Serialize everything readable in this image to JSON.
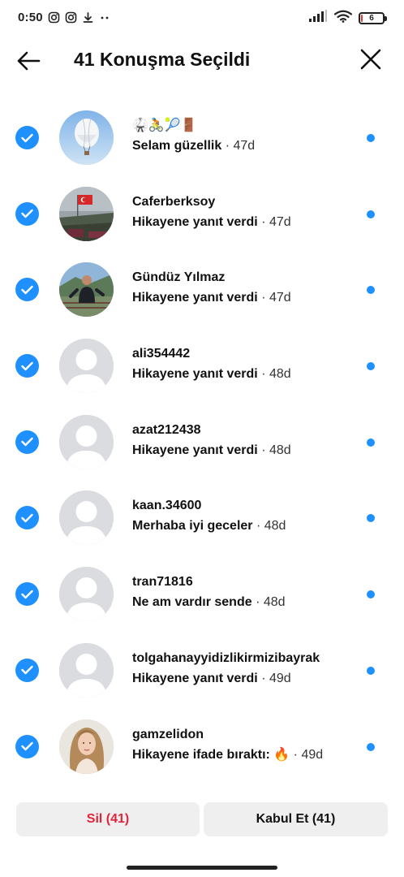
{
  "status_bar": {
    "time": "0:50",
    "left_icons": [
      "instagram-icon",
      "instagram-icon",
      "download-icon",
      "more-dots-icon"
    ],
    "right_icons": [
      "signal-icon",
      "wifi-icon",
      "battery-icon"
    ],
    "battery_level": "6"
  },
  "header": {
    "title": "41 Konuşma Seçildi",
    "back_icon": "arrow-left-icon",
    "close_icon": "close-icon"
  },
  "conversations": [
    {
      "name": "🥋🚴🎾🚪",
      "message": "Selam güzellik",
      "time": "· 47d",
      "avatar": "balloon-photo",
      "selected": true,
      "unread": true
    },
    {
      "name": "Caferberksoy",
      "message": "Hikayene yanıt verdi",
      "time": "· 47d",
      "avatar": "flag-photo",
      "selected": true,
      "unread": true
    },
    {
      "name": "Gündüz Yılmaz",
      "message": "Hikayene yanıt verdi",
      "time": "· 47d",
      "avatar": "person-photo",
      "selected": true,
      "unread": true
    },
    {
      "name": "ali354442",
      "message": "Hikayene yanıt verdi",
      "time": "· 48d",
      "avatar": "default-avatar",
      "selected": true,
      "unread": true
    },
    {
      "name": "azat212438",
      "message": "Hikayene yanıt verdi",
      "time": "· 48d",
      "avatar": "default-avatar",
      "selected": true,
      "unread": true
    },
    {
      "name": "kaan.34600",
      "message": "Merhaba iyi geceler",
      "time": "· 48d",
      "avatar": "default-avatar",
      "selected": true,
      "unread": true
    },
    {
      "name": "tran71816",
      "message": "Ne am vardır sende",
      "time": "· 48d",
      "avatar": "default-avatar",
      "selected": true,
      "unread": true
    },
    {
      "name": "tolgahanayyidizlikirmizibayrak",
      "message": "Hikayene yanıt verdi",
      "time": "· 49d",
      "avatar": "default-avatar",
      "selected": true,
      "unread": true
    },
    {
      "name": "gamzelidon",
      "message": "Hikayene ifade bıraktı: 🔥",
      "time": "· 49d",
      "avatar": "woman-photo",
      "selected": true,
      "unread": true
    }
  ],
  "actions": {
    "delete_label": "Sil (41)",
    "accept_label": "Kabul Et (41)"
  },
  "colors": {
    "accent": "#1e90ff",
    "danger": "#e0243a",
    "button_bg": "#efefef"
  }
}
